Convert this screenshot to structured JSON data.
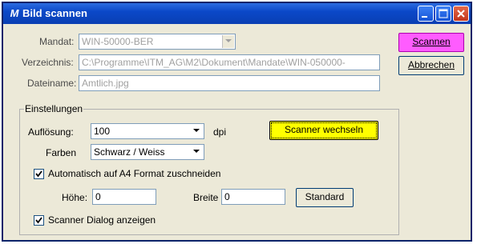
{
  "window": {
    "title": "Bild scannen",
    "app_icon_glyph": "M"
  },
  "form": {
    "mandat": {
      "label": "Mandat:",
      "value": "WIN-50000-BER"
    },
    "verzeichnis": {
      "label": "Verzeichnis:",
      "value": "C:\\Programme\\ITM_AG\\M2\\Dokument\\Mandate\\WIN-050000-"
    },
    "dateiname": {
      "label": "Dateiname:",
      "value": "Amtlich.jpg"
    }
  },
  "buttons": {
    "scannen": "Scannen",
    "abbrechen": "Abbrechen"
  },
  "settings": {
    "group_title": "Einstellungen",
    "aufloesung": {
      "label": "Auflösung:",
      "value": "100",
      "unit": "dpi"
    },
    "farben": {
      "label": "Farben",
      "value": "Schwarz / Weiss"
    },
    "scanner_wechseln": "Scanner wechseln",
    "auto_a4": {
      "label": "Automatisch auf A4 Format zuschneiden",
      "checked": true
    },
    "hoehe": {
      "label": "Höhe:",
      "value": "0"
    },
    "breite": {
      "label": "Breite",
      "value": "0"
    },
    "standard": "Standard",
    "scanner_dialog": {
      "label": "Scanner Dialog anzeigen",
      "checked": true
    }
  },
  "colors": {
    "scannen_button": "#ff5cff",
    "scanner_wechseln_button": "#ffff00",
    "titlebar": "#0b48c8"
  }
}
